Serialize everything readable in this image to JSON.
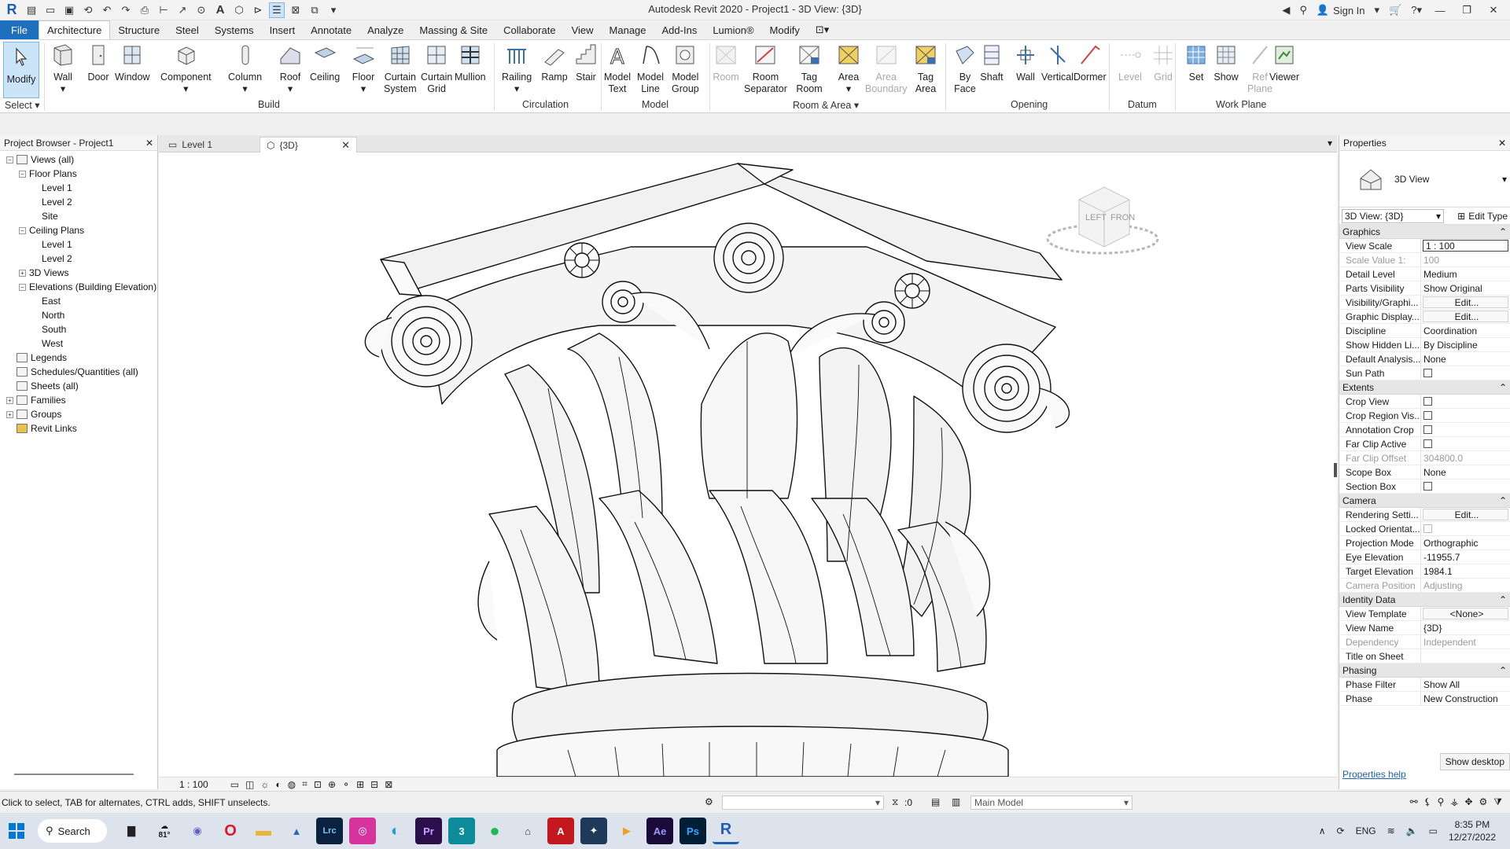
{
  "app": {
    "title": "Autodesk Revit 2020 - Project1 - 3D View: {3D}",
    "sign_in": "Sign In"
  },
  "ribbon_tabs": [
    "File",
    "Architecture",
    "Structure",
    "Steel",
    "Systems",
    "Insert",
    "Annotate",
    "Analyze",
    "Massing & Site",
    "Collaborate",
    "View",
    "Manage",
    "Add-Ins",
    "Lumion®",
    "Modify"
  ],
  "ribbon": {
    "modify": "Modify",
    "select": "Select",
    "groups": {
      "build": "Build",
      "circulation": "Circulation",
      "model": "Model",
      "room_area": "Room & Area",
      "opening": "Opening",
      "datum": "Datum",
      "work_plane": "Work Plane"
    },
    "tools": {
      "wall": "Wall",
      "door": "Door",
      "window": "Window",
      "component": "Component",
      "column": "Column",
      "roof": "Roof",
      "ceiling": "Ceiling",
      "floor": "Floor",
      "curtain_system": "Curtain\nSystem",
      "curtain_grid": "Curtain\nGrid",
      "mullion": "Mullion",
      "railing": "Railing",
      "ramp": "Ramp",
      "stair": "Stair",
      "model_text": "Model\nText",
      "model_line": "Model\nLine",
      "model_group": "Model\nGroup",
      "room": "Room",
      "room_separator": "Room\nSeparator",
      "tag_room": "Tag\nRoom",
      "area": "Area",
      "area_boundary": "Area\nBoundary",
      "tag_area": "Tag\nArea",
      "by_face": "By\nFace",
      "shaft": "Shaft",
      "wall_op": "Wall",
      "vertical": "Vertical",
      "dormer": "Dormer",
      "level": "Level",
      "grid": "Grid",
      "set": "Set",
      "show": "Show",
      "ref_plane": "Ref\nPlane",
      "viewer": "Viewer"
    }
  },
  "project_browser": {
    "title": "Project Browser - Project1",
    "items": [
      {
        "label": "Views (all)",
        "indent": 0,
        "toggle": "−",
        "icon": "views-icon"
      },
      {
        "label": "Floor Plans",
        "indent": 1,
        "toggle": "−",
        "icon": ""
      },
      {
        "label": "Level 1",
        "indent": 2,
        "toggle": "",
        "icon": ""
      },
      {
        "label": "Level 2",
        "indent": 2,
        "toggle": "",
        "icon": ""
      },
      {
        "label": "Site",
        "indent": 2,
        "toggle": "",
        "icon": ""
      },
      {
        "label": "Ceiling Plans",
        "indent": 1,
        "toggle": "−",
        "icon": ""
      },
      {
        "label": "Level 1",
        "indent": 2,
        "toggle": "",
        "icon": ""
      },
      {
        "label": "Level 2",
        "indent": 2,
        "toggle": "",
        "icon": ""
      },
      {
        "label": "3D Views",
        "indent": 1,
        "toggle": "+",
        "icon": ""
      },
      {
        "label": "Elevations (Building Elevation)",
        "indent": 1,
        "toggle": "−",
        "icon": ""
      },
      {
        "label": "East",
        "indent": 2,
        "toggle": "",
        "icon": ""
      },
      {
        "label": "North",
        "indent": 2,
        "toggle": "",
        "icon": ""
      },
      {
        "label": "South",
        "indent": 2,
        "toggle": "",
        "icon": ""
      },
      {
        "label": "West",
        "indent": 2,
        "toggle": "",
        "icon": ""
      },
      {
        "label": "Legends",
        "indent": 0,
        "toggle": "",
        "icon": "legends-icon"
      },
      {
        "label": "Schedules/Quantities (all)",
        "indent": 0,
        "toggle": "",
        "icon": "schedules-icon"
      },
      {
        "label": "Sheets (all)",
        "indent": 0,
        "toggle": "",
        "icon": "sheets-icon"
      },
      {
        "label": "Families",
        "indent": 0,
        "toggle": "+",
        "icon": "families-icon"
      },
      {
        "label": "Groups",
        "indent": 0,
        "toggle": "+",
        "icon": "groups-icon"
      },
      {
        "label": "Revit Links",
        "indent": 0,
        "toggle": "",
        "icon": "links-icon"
      }
    ]
  },
  "view_tabs": [
    {
      "label": "Level 1"
    },
    {
      "label": "{3D}"
    }
  ],
  "viewcube": {
    "left": "LEFT",
    "front": "FRON"
  },
  "view_scale_bottom": "1 : 100",
  "properties": {
    "title": "Properties",
    "type_name": "3D View",
    "instance": "3D View: {3D}",
    "edit_type": "Edit Type",
    "sections": [
      {
        "name": "Graphics",
        "rows": [
          {
            "k": "View Scale",
            "v": "1 : 100",
            "style": "boxed"
          },
          {
            "k": "Scale Value    1:",
            "v": "100",
            "style": "dis"
          },
          {
            "k": "Detail Level",
            "v": "Medium"
          },
          {
            "k": "Parts Visibility",
            "v": "Show Original"
          },
          {
            "k": "Visibility/Graphi...",
            "v": "Edit...",
            "style": "btn"
          },
          {
            "k": "Graphic Display...",
            "v": "Edit...",
            "style": "btn"
          },
          {
            "k": "Discipline",
            "v": "Coordination"
          },
          {
            "k": "Show Hidden Li...",
            "v": "By Discipline"
          },
          {
            "k": "Default Analysis...",
            "v": "None"
          },
          {
            "k": "Sun Path",
            "v": "",
            "style": "check"
          }
        ]
      },
      {
        "name": "Extents",
        "rows": [
          {
            "k": "Crop View",
            "v": "",
            "style": "check"
          },
          {
            "k": "Crop Region Vis...",
            "v": "",
            "style": "check"
          },
          {
            "k": "Annotation Crop",
            "v": "",
            "style": "check"
          },
          {
            "k": "Far Clip Active",
            "v": "",
            "style": "check"
          },
          {
            "k": "Far Clip Offset",
            "v": "304800.0",
            "style": "dis"
          },
          {
            "k": "Scope Box",
            "v": "None"
          },
          {
            "k": "Section Box",
            "v": "",
            "style": "check"
          }
        ]
      },
      {
        "name": "Camera",
        "rows": [
          {
            "k": "Rendering Setti...",
            "v": "Edit...",
            "style": "btn"
          },
          {
            "k": "Locked Orientat...",
            "v": "",
            "style": "checkdis"
          },
          {
            "k": "Projection Mode",
            "v": "Orthographic"
          },
          {
            "k": "Eye Elevation",
            "v": "-11955.7"
          },
          {
            "k": "Target Elevation",
            "v": "1984.1"
          },
          {
            "k": "Camera Position",
            "v": "Adjusting",
            "style": "dis"
          }
        ]
      },
      {
        "name": "Identity Data",
        "rows": [
          {
            "k": "View Template",
            "v": "<None>",
            "style": "btn"
          },
          {
            "k": "View Name",
            "v": "{3D}"
          },
          {
            "k": "Dependency",
            "v": "Independent",
            "style": "dis"
          },
          {
            "k": "Title on Sheet",
            "v": ""
          }
        ]
      },
      {
        "name": "Phasing",
        "rows": [
          {
            "k": "Phase Filter",
            "v": "Show All"
          },
          {
            "k": "Phase",
            "v": "New Construction"
          }
        ]
      }
    ],
    "help": "Properties help",
    "show_desktop": "Show desktop"
  },
  "status": {
    "message": "Click to select, TAB for alternates, CTRL adds, SHIFT unselects.",
    "filter_count": ":0",
    "model": "Main Model"
  },
  "taskbar": {
    "search": "Search",
    "weather": "81°",
    "lang": "ENG",
    "time": "8:35 PM",
    "date": "12/27/2022"
  },
  "colors": {
    "file_tab": "#1f6fbf",
    "accent": "#1e5fb3"
  }
}
